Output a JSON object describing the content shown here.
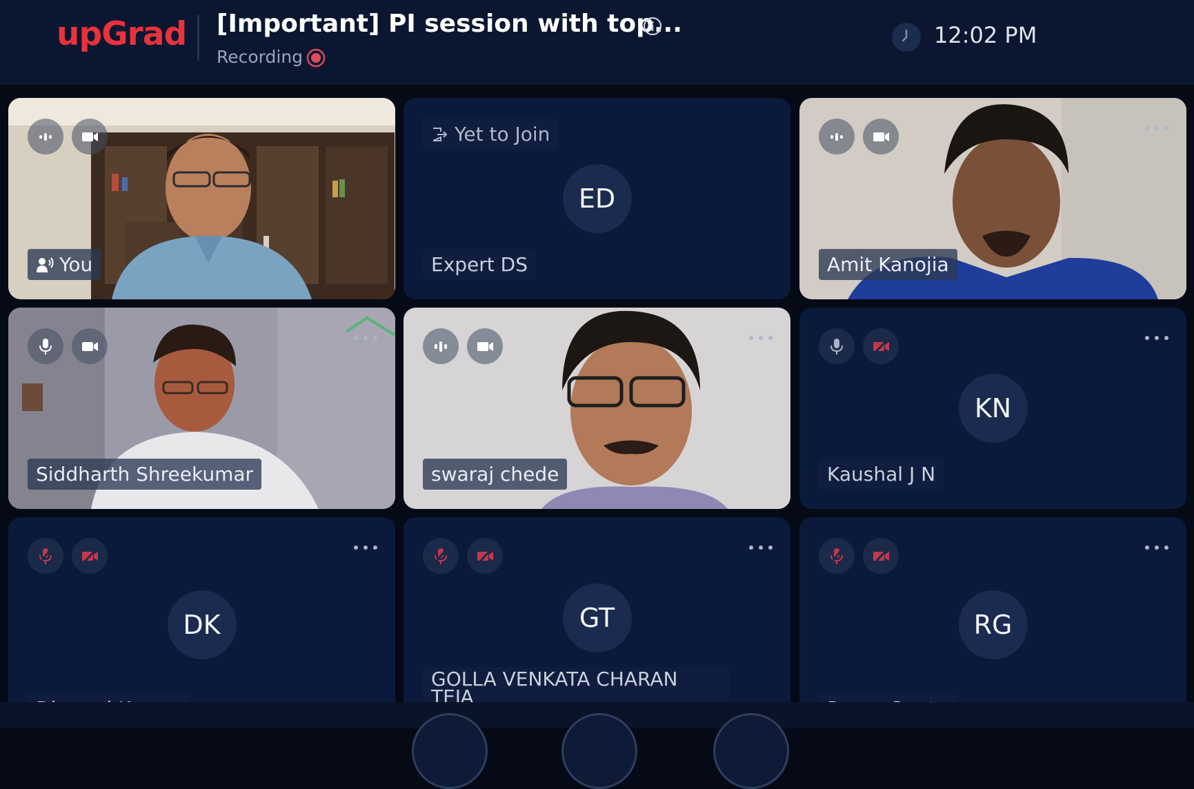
{
  "header": {
    "logo": "upGrad",
    "title": "[Important] PI session with top...",
    "recording_label": "Recording",
    "time": "12:02 PM"
  },
  "tiles": [
    {
      "name": "You",
      "video": true,
      "mic": "active",
      "cam": "on"
    },
    {
      "name": "Expert DS",
      "status": "Yet to Join",
      "initials": "ED"
    },
    {
      "name": "Amit Kanojia",
      "video": true,
      "mic": "active",
      "cam": "on"
    },
    {
      "name": "Siddharth Shreekumar",
      "video": true,
      "mic": "on",
      "cam": "on"
    },
    {
      "name": "swaraj chede",
      "video": true,
      "mic": "active",
      "cam": "on"
    },
    {
      "name": "Kaushal J N",
      "initials": "KN",
      "mic": "on",
      "cam": "off"
    },
    {
      "name": "Dheeraj Kumar",
      "initials": "DK",
      "mic": "off",
      "cam": "off"
    },
    {
      "name": "GOLLA VENKATA CHARAN TEJA",
      "initials": "GT",
      "mic": "off",
      "cam": "off"
    },
    {
      "name": "Rama Gupta",
      "initials": "RG",
      "mic": "off",
      "cam": "off"
    }
  ],
  "colors": {
    "background": "#050a16",
    "header": "#0b1730",
    "tile": "#0b1a3b",
    "brand_red": "#e8323c",
    "muted_red": "#c2384d"
  },
  "icons": [
    "info-icon",
    "recording-icon",
    "clock-icon",
    "audio-level-icon",
    "camera-icon",
    "mic-icon",
    "mic-off-icon",
    "camera-off-icon",
    "more-icon",
    "speaker-icon",
    "leave-icon"
  ]
}
